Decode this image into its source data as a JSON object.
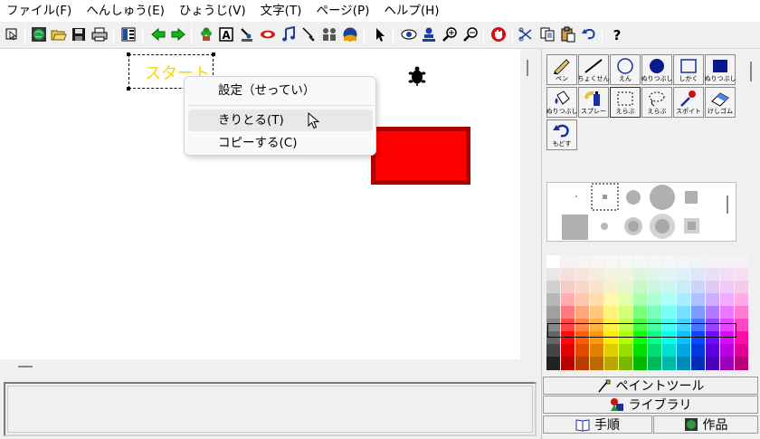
{
  "menubar": {
    "items": [
      "ファイル(F)",
      "へんしゅう(E)",
      "ひょうじ(V)",
      "文字(T)",
      "ページ(P)",
      "ヘルプ(H)"
    ]
  },
  "toolbar": {
    "icons": [
      "select-icon",
      "globe-icon",
      "open-icon",
      "save-icon",
      "print-icon",
      "layout-icon",
      "back-icon",
      "forward-icon",
      "plant-icon",
      "text-icon",
      "lamp-icon",
      "eye-mask-icon",
      "music-icon",
      "brush-icon",
      "people-icon",
      "ball-icon",
      "pointer-icon",
      "eye-icon",
      "person-icon",
      "zoom-in-icon",
      "zoom-out-icon",
      "stop-icon",
      "cut-icon",
      "copy-icon",
      "paste-icon",
      "undo-icon",
      "help-icon"
    ]
  },
  "canvas": {
    "sprite_text": "スタート"
  },
  "context_menu": {
    "items": [
      "設定（せってい）",
      "きりとる(T)",
      "コピーする(C)"
    ]
  },
  "paint_tools": {
    "labels": [
      "ペン",
      "ちょくせん",
      "えん",
      "ぬりつぶし",
      "しかく",
      "ぬりつぶし",
      "ぬりつぶし",
      "スプレー",
      "えらぶ",
      "えらぶ",
      "スポイト",
      "けしゴム",
      "もどす"
    ]
  },
  "tabs": {
    "paint_tool": "ペイントツール",
    "library": "ライブラリ",
    "procedure": "手順",
    "works": "作品"
  },
  "colors": {
    "accent_red": "#ff0000",
    "sprite_yellow": "#ffd400"
  }
}
